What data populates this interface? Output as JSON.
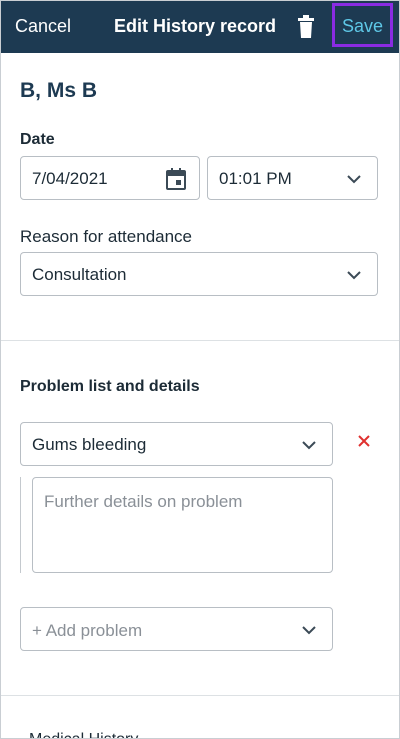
{
  "header": {
    "cancel_label": "Cancel",
    "title": "Edit History record",
    "save_label": "Save",
    "trash_icon": "trash-icon"
  },
  "patient": {
    "name": "B, Ms B"
  },
  "date_section": {
    "label": "Date",
    "date_value": "7/04/2021",
    "time_value": "01:01 PM",
    "calendar_icon": "calendar-icon"
  },
  "reason": {
    "label": "Reason for attendance",
    "value": "Consultation"
  },
  "problems": {
    "heading": "Problem list and details",
    "items": [
      {
        "value": "Gums bleeding",
        "details_placeholder": "Further details on problem"
      }
    ],
    "add_placeholder": "+ Add problem"
  },
  "medical_history": {
    "label": "Medical History"
  },
  "colors": {
    "header_bg": "#1d3a52",
    "save_text": "#5ec7e6",
    "highlight_border": "#8a2be2",
    "remove_red": "#e0312f"
  }
}
